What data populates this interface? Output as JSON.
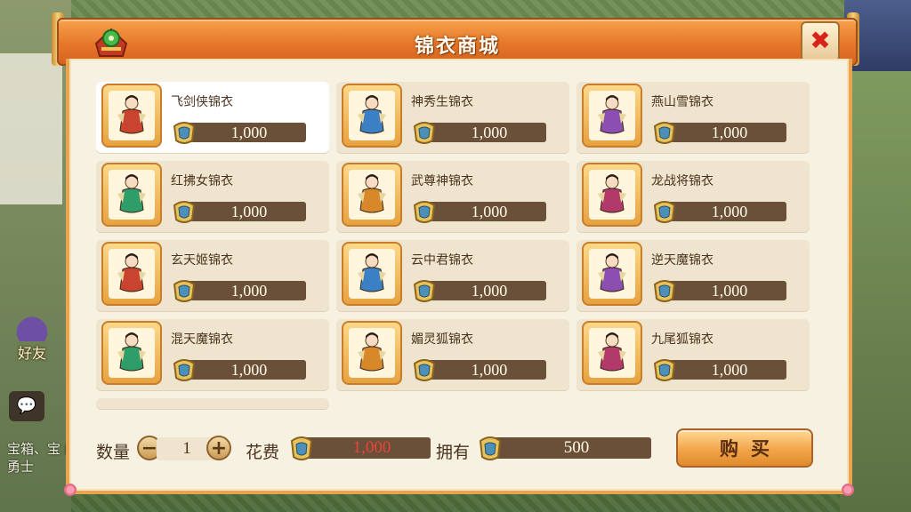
{
  "dialog": {
    "title": "锦衣商城",
    "close_label": "✖"
  },
  "items": [
    {
      "name": "飞剑侠锦衣",
      "price": "1,000",
      "selected": true
    },
    {
      "name": "神秀生锦衣",
      "price": "1,000",
      "selected": false
    },
    {
      "name": "燕山雪锦衣",
      "price": "1,000",
      "selected": false
    },
    {
      "name": "红拂女锦衣",
      "price": "1,000",
      "selected": false
    },
    {
      "name": "武尊神锦衣",
      "price": "1,000",
      "selected": false
    },
    {
      "name": "龙战将锦衣",
      "price": "1,000",
      "selected": false
    },
    {
      "name": "玄天姬锦衣",
      "price": "1,000",
      "selected": false
    },
    {
      "name": "云中君锦衣",
      "price": "1,000",
      "selected": false
    },
    {
      "name": "逆天魔锦衣",
      "price": "1,000",
      "selected": false
    },
    {
      "name": "混天魔锦衣",
      "price": "1,000",
      "selected": false
    },
    {
      "name": "媚灵狐锦衣",
      "price": "1,000",
      "selected": false
    },
    {
      "name": "九尾狐锦衣",
      "price": "1,000",
      "selected": false
    }
  ],
  "footer": {
    "quantity_label": "数量",
    "minus_label": "−",
    "plus_label": "+",
    "quantity_value": "1",
    "cost_label": "花费",
    "cost_value": "1,000",
    "own_label": "拥有",
    "own_value": "500",
    "buy_label": "购买"
  },
  "background_ui": {
    "friend_label": "好友",
    "chat_text": "宝箱、宝 的勇士"
  },
  "colors": {
    "title_bar": "#e6772a",
    "panel": "#f7f1e2",
    "price_bar": "#6b5039",
    "cost_text": "#e8453b",
    "close_x": "#d8231b"
  }
}
